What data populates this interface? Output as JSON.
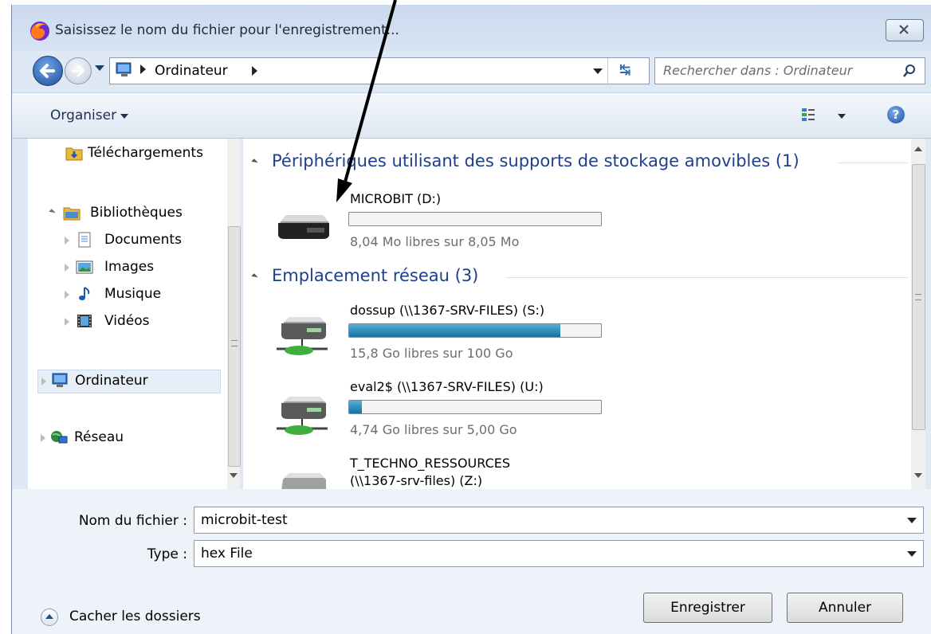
{
  "window": {
    "title": "Saisissez le nom du fichier pour l'enregistrement...",
    "close_label": "close"
  },
  "address_bar": {
    "path": "Ordinateur",
    "search_placeholder": "Rechercher dans : Ordinateur"
  },
  "toolbar": {
    "organise_label": "Organiser"
  },
  "nav_pane": {
    "items": [
      {
        "label": "Téléchargements",
        "icon": "downloads-folder-icon"
      },
      {
        "label": "Bibliothèques",
        "icon": "libraries-icon"
      },
      {
        "label": "Documents",
        "icon": "documents-icon"
      },
      {
        "label": "Images",
        "icon": "images-icon"
      },
      {
        "label": "Musique",
        "icon": "music-icon"
      },
      {
        "label": "Vidéos",
        "icon": "videos-icon"
      },
      {
        "label": "Ordinateur",
        "icon": "computer-icon"
      },
      {
        "label": "Réseau",
        "icon": "network-icon"
      }
    ]
  },
  "content": {
    "groups": [
      {
        "title": "Périphériques utilisant des supports de stockage amovibles (1)",
        "drives": [
          {
            "name": "MICROBIT (D:)",
            "free": "8,04 Mo libres sur 8,05 Mo",
            "used_fraction": 0.0
          }
        ]
      },
      {
        "title": "Emplacement réseau (3)",
        "drives": [
          {
            "name": "dossup (\\\\1367-SRV-FILES) (S:)",
            "free": "15,8 Go libres sur 100 Go",
            "used_fraction": 0.84
          },
          {
            "name": "eval2$ (\\\\1367-SRV-FILES) (U:)",
            "free": "4,74 Go libres sur 5,00 Go",
            "used_fraction": 0.05
          },
          {
            "name": "T_TECHNO_RESSOURCES",
            "name2": "(\\\\1367-srv-files) (Z:)"
          }
        ]
      }
    ]
  },
  "form": {
    "filename_label": "Nom du fichier :",
    "filename_value": "microbit-test",
    "type_label": "Type :",
    "type_value": "hex File"
  },
  "footer": {
    "hide_folders_label": "Cacher les dossiers",
    "save_label": "Enregistrer",
    "cancel_label": "Annuler"
  },
  "colors": {
    "group_title": "#1e3f8a",
    "bar_fill": "#1b6ea1",
    "dialog_bg": "#dfe9f5"
  }
}
